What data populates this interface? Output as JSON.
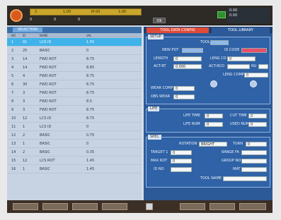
{
  "topbar": {
    "strip_texts": [
      "2",
      "1.00",
      "M 00",
      "1:00"
    ],
    "row_texts": [
      "0",
      "0",
      "0"
    ],
    "center_button": "OK",
    "info_lines": [
      "0.00",
      "0.00"
    ]
  },
  "left": {
    "title": "SELECTION",
    "columns": [
      "NO",
      "ID",
      "NAME",
      "VAL"
    ],
    "rows": [
      {
        "no": "1",
        "id": "01",
        "name": "LCS ID",
        "val": "1.55"
      },
      {
        "no": "2",
        "id": "25",
        "name": "BASIC",
        "val": "0"
      },
      {
        "no": "3",
        "id": "14",
        "name": "FWD ROT",
        "val": "8.75"
      },
      {
        "no": "4",
        "id": "14",
        "name": "FWD ROT",
        "val": "8.85"
      },
      {
        "no": "5",
        "id": "4",
        "name": "FWD ROT",
        "val": "8.75"
      },
      {
        "no": "6",
        "id": "30",
        "name": "FWD ROT",
        "val": "8.75"
      },
      {
        "no": "7",
        "id": "3",
        "name": "FWD ROT",
        "val": "8.75"
      },
      {
        "no": "8",
        "id": "3",
        "name": "FWD ROT",
        "val": "8.5"
      },
      {
        "no": "9",
        "id": "3",
        "name": "FWD ROT",
        "val": "8.75"
      },
      {
        "no": "10",
        "id": "12",
        "name": "LCS ID",
        "val": "8.75"
      },
      {
        "no": "11",
        "id": "1",
        "name": "LCS ID",
        "val": "0"
      },
      {
        "no": "12",
        "id": "2",
        "name": "BASIC",
        "val": "0.75"
      },
      {
        "no": "13",
        "id": "1",
        "name": "BASIC",
        "val": "0"
      },
      {
        "no": "14",
        "id": "2",
        "name": "BASIC",
        "val": "0.35"
      },
      {
        "no": "15",
        "id": "12",
        "name": "LCS ROT",
        "val": "1.45"
      },
      {
        "no": "16",
        "id": "1",
        "name": "BASIC",
        "val": "1.45"
      }
    ]
  },
  "right": {
    "tab_active": "TOOL DATA CONFIG",
    "tab_inactive": "TOOL LIBRARY",
    "sec1": {
      "title": "SETUP",
      "tag": "TOOL",
      "tag_value": "",
      "row1": {
        "label_left": "NEW POT",
        "value_left": "",
        "label_right": "ID CODE",
        "value_right": ""
      },
      "row2": {
        "label_left": "LENGTH",
        "value_left": "0",
        "label_mid": "LENG CO",
        "value_mid": "0"
      },
      "row3": {
        "label_left": "ACT-RT",
        "value_left": "0.000",
        "label_mid": "ACT-RCO",
        "value_mid": "",
        "label_right": "NU",
        "value_right": ""
      },
      "row4": {
        "label": "LENG COMP",
        "value": "0"
      },
      "row5": {
        "label": "WEAR COMP",
        "value": "0"
      },
      "row6": {
        "label": "OBS WEAR",
        "value": "0"
      }
    },
    "sec2": {
      "title": "LIFE",
      "life_time_label": "LIFE TIME",
      "life_time": "0",
      "cut_time_label": "CUT TIME",
      "cut_time": "0",
      "life_num_label": "LIFE NUM",
      "life_num": "0",
      "used_num_label": "USED NUM",
      "used_num": "0"
    },
    "sec3": {
      "title": "SPEC",
      "rotation_label": "ROTATION",
      "rotation": "BRIGHT",
      "turn_label": "TURN",
      "turn": "0",
      "target_label": "TARGET 1",
      "target": "0",
      "range_label": "RANGE FA",
      "range": "",
      "max_rot_label": "MAX ROT",
      "max_rot": "0",
      "group_label": "GROUP NO",
      "group": "",
      "id_label": "ID NO",
      "id": "",
      "mat_label": "MAT",
      "mat": "",
      "tool_label": "TOOL NAME",
      "tool": ""
    }
  },
  "colors": {
    "accent": "#3fb2ea",
    "panel": "#2f62a6",
    "header": "#3b6fa8",
    "alert": "#e8506a"
  }
}
